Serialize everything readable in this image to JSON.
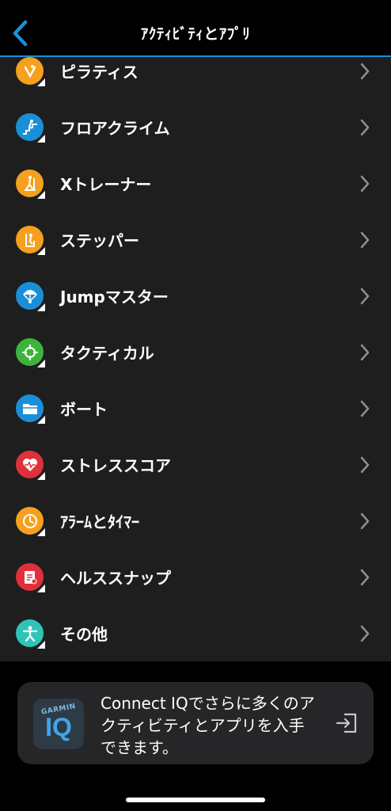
{
  "header": {
    "title": "ｱｸﾃｨﾋﾞﾃｨとｱﾌﾟﾘ",
    "back_icon": "chevron-left-icon",
    "accent": "#1a8fd8"
  },
  "list": {
    "items": [
      {
        "label": "ピラティス",
        "icon": "pilates-icon",
        "color": "#f5a01e"
      },
      {
        "label": "フロアクライム",
        "icon": "floor-climb-icon",
        "color": "#1a8fd8"
      },
      {
        "label": "Xトレーナー",
        "icon": "elliptical-icon",
        "color": "#f5a01e"
      },
      {
        "label": "ステッパー",
        "icon": "stepper-icon",
        "color": "#f5a01e"
      },
      {
        "label": "Jumpマスター",
        "icon": "parachute-icon",
        "color": "#1a8fd8"
      },
      {
        "label": "タクティカル",
        "icon": "crosshair-icon",
        "color": "#3cb43c"
      },
      {
        "label": "ボート",
        "icon": "folder-icon",
        "color": "#1a8fd8"
      },
      {
        "label": "ストレススコア",
        "icon": "heart-pulse-icon",
        "color": "#e0303c"
      },
      {
        "label": "ｱﾗｰﾑとﾀｲﾏｰ",
        "icon": "clock-icon",
        "color": "#f5a01e"
      },
      {
        "label": "ヘルススナップ",
        "icon": "health-report-icon",
        "color": "#e0303c"
      },
      {
        "label": "その他",
        "icon": "person-icon",
        "color": "#2ec4b6"
      }
    ],
    "chevron_icon": "chevron-right-icon"
  },
  "connect_iq": {
    "logo_brand": "GARMIN",
    "logo_text": "IQ",
    "message": "Connect IQでさらに多くのアクティビティとアプリを入手できます。",
    "exit_icon": "open-external-icon"
  }
}
